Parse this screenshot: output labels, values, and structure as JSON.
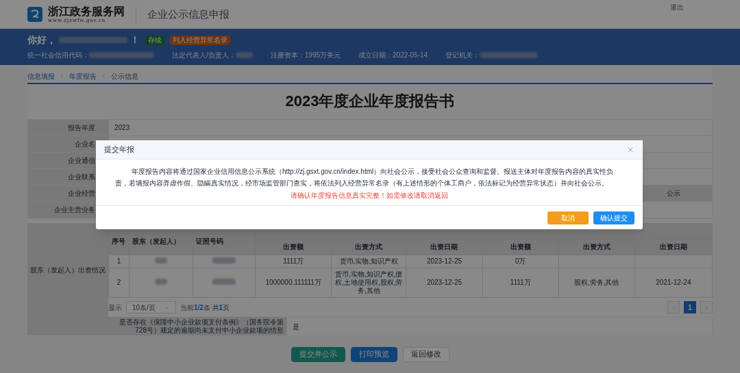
{
  "header": {
    "site_name": "浙江政务服务网",
    "site_url": "www.zjzwfw.gov.cn",
    "app_title": "企业公示信息申报",
    "logout": "退出"
  },
  "company_bar": {
    "greeting": "你好，",
    "greeting_end": "！",
    "badges": [
      {
        "label": "存续",
        "kind": "status"
      },
      {
        "label": "列入经营异常名录",
        "kind": "abnormal"
      }
    ],
    "fields": [
      {
        "label": "统一社会信用代码：",
        "redacted": true
      },
      {
        "label": "法定代表人/负责人：",
        "redacted": true
      },
      {
        "label": "注册资本：",
        "value": "1995万美元",
        "redacted": false
      },
      {
        "label": "成立日期：",
        "value": "2022-05-14",
        "redacted": false
      },
      {
        "label": "登记机关：",
        "redacted": true
      }
    ]
  },
  "breadcrumb": [
    {
      "label": "信息填报",
      "kind": "link"
    },
    {
      "label": "年度报告",
      "kind": "link"
    },
    {
      "label": "公示信息",
      "kind": "current"
    }
  ],
  "title": "2023年度企业年度报告书",
  "form_rows": [
    {
      "label": "报告年度",
      "value": "2023"
    },
    {
      "label": "企业名"
    },
    {
      "label": "企业通信"
    },
    {
      "label": "企业联系"
    },
    {
      "label": "企业经营",
      "column_3": "公示"
    },
    {
      "label": "企业主营业务"
    }
  ],
  "shareholders": {
    "label": "股东（发起人）出资情况",
    "columns": [
      "序号",
      "股东（发起人）",
      "证照号码"
    ],
    "sub_columns": [
      "出资额",
      "出资方式",
      "出资日期",
      "出资额",
      "出资方式",
      "出资日期"
    ],
    "rows": [
      {
        "cells": [
          {
            "kind": "text",
            "text": "1"
          },
          {
            "kind": "redacted"
          },
          {
            "kind": "redacted"
          },
          {
            "kind": "text",
            "text": "1111万"
          },
          {
            "kind": "text",
            "text": "货币,实物,知识产权"
          },
          {
            "kind": "text",
            "text": "2023-12-25"
          },
          {
            "kind": "text",
            "text": "0万"
          },
          {
            "kind": "empty"
          },
          {
            "kind": "empty"
          }
        ]
      },
      {
        "cells": [
          {
            "kind": "text",
            "text": "2"
          },
          {
            "kind": "redacted"
          },
          {
            "kind": "redacted"
          },
          {
            "kind": "text",
            "text": "1000000.111111万"
          },
          {
            "kind": "text",
            "text": "货币,实物,知识产权,债权,土地使用权,股权,劳务,其他"
          },
          {
            "kind": "text",
            "text": "2023-12-25"
          },
          {
            "kind": "text",
            "text": "1111万"
          },
          {
            "kind": "text",
            "text": "股权,劳务,其他"
          },
          {
            "kind": "text",
            "text": "2021-12-24"
          }
        ]
      }
    ],
    "pagination": {
      "show_label": "显示",
      "page_size": "10条/页",
      "summary": "当前**1/2**条 共**1**页",
      "pages": [
        {
          "label": "1",
          "selected": true
        }
      ]
    }
  },
  "question_row": {
    "question": "是否存在《保障中小企业款项支付条例》（国务院令第728号）规定的逾期尚未支付中小企业款项的情形",
    "answer": "是"
  },
  "actions": [
    {
      "label": "提交并公示",
      "kind": "submit"
    },
    {
      "label": "打印预览",
      "kind": "primary"
    },
    {
      "label": "返回修改",
      "kind": "default"
    }
  ],
  "modal": {
    "title": "提交年报",
    "paragraph": "年度报告内容将通过国家企业信用信息公示系统（http://zj.gsxt.gov.cn/index.html）向社会公示，接受社会公众查询和监督。报送主体对年度报告内容的真实性负责，若填报内容弄虚作假、隐瞒真实情况，经市场监管部门查实，将依法列入经营异常名录（有上述情形的个体工商户，依法标记为经营异常状态）并向社会公示。",
    "warning": "请确认年度报告信息真实完整！如需修改请取消返回",
    "buttons": [
      {
        "label": "取消",
        "kind": "cancel"
      },
      {
        "label": "确认提交",
        "kind": "confirm"
      }
    ]
  }
}
